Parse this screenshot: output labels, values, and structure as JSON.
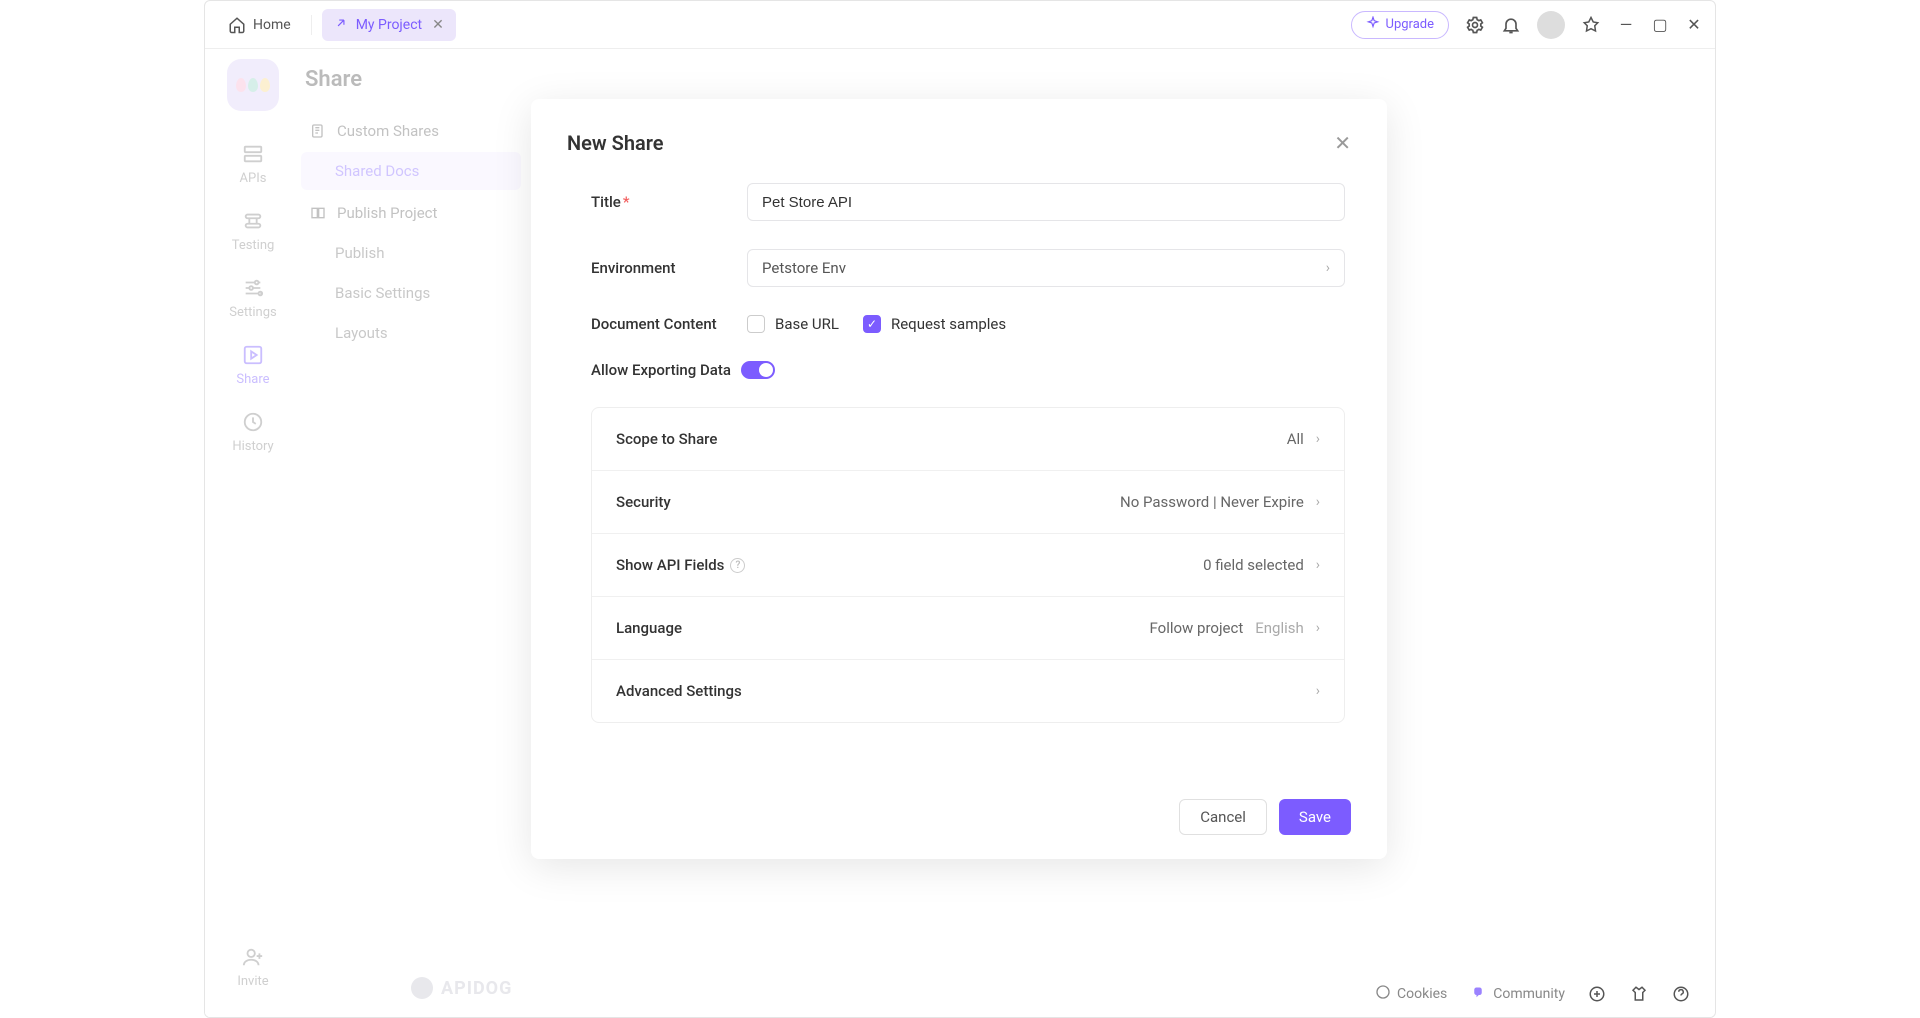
{
  "titlebar": {
    "home_label": "Home",
    "project_tab": "My Project",
    "upgrade_label": "Upgrade"
  },
  "left_rail": {
    "items": [
      {
        "label": "APIs"
      },
      {
        "label": "Testing"
      },
      {
        "label": "Settings"
      },
      {
        "label": "Share"
      },
      {
        "label": "History"
      }
    ],
    "invite_label": "Invite"
  },
  "sidebar": {
    "title": "Share",
    "groups": [
      {
        "label": "Custom Shares",
        "children": [
          {
            "label": "Shared Docs",
            "selected": true
          }
        ]
      },
      {
        "label": "Publish Project",
        "children": [
          {
            "label": "Publish"
          },
          {
            "label": "Basic Settings"
          },
          {
            "label": "Layouts"
          }
        ]
      }
    ]
  },
  "modal": {
    "title": "New Share",
    "fields": {
      "title_label": "Title",
      "title_value": "Pet Store API",
      "environment_label": "Environment",
      "environment_value": "Petstore Env",
      "doc_content_label": "Document Content",
      "checkbox_base_url": "Base URL",
      "checkbox_request_samples": "Request samples",
      "allow_export_label": "Allow Exporting Data"
    },
    "settings": {
      "scope": {
        "label": "Scope to Share",
        "value": "All"
      },
      "security": {
        "label": "Security",
        "value": "No Password | Never Expire"
      },
      "show_fields": {
        "label": "Show API Fields",
        "value": "0 field selected"
      },
      "language": {
        "label": "Language",
        "value": "Follow project",
        "value2": "English"
      },
      "advanced": {
        "label": "Advanced Settings"
      }
    },
    "buttons": {
      "cancel": "Cancel",
      "save": "Save"
    }
  },
  "status_bar": {
    "cookies": "Cookies",
    "community": "Community"
  },
  "brand": "APIDOG"
}
